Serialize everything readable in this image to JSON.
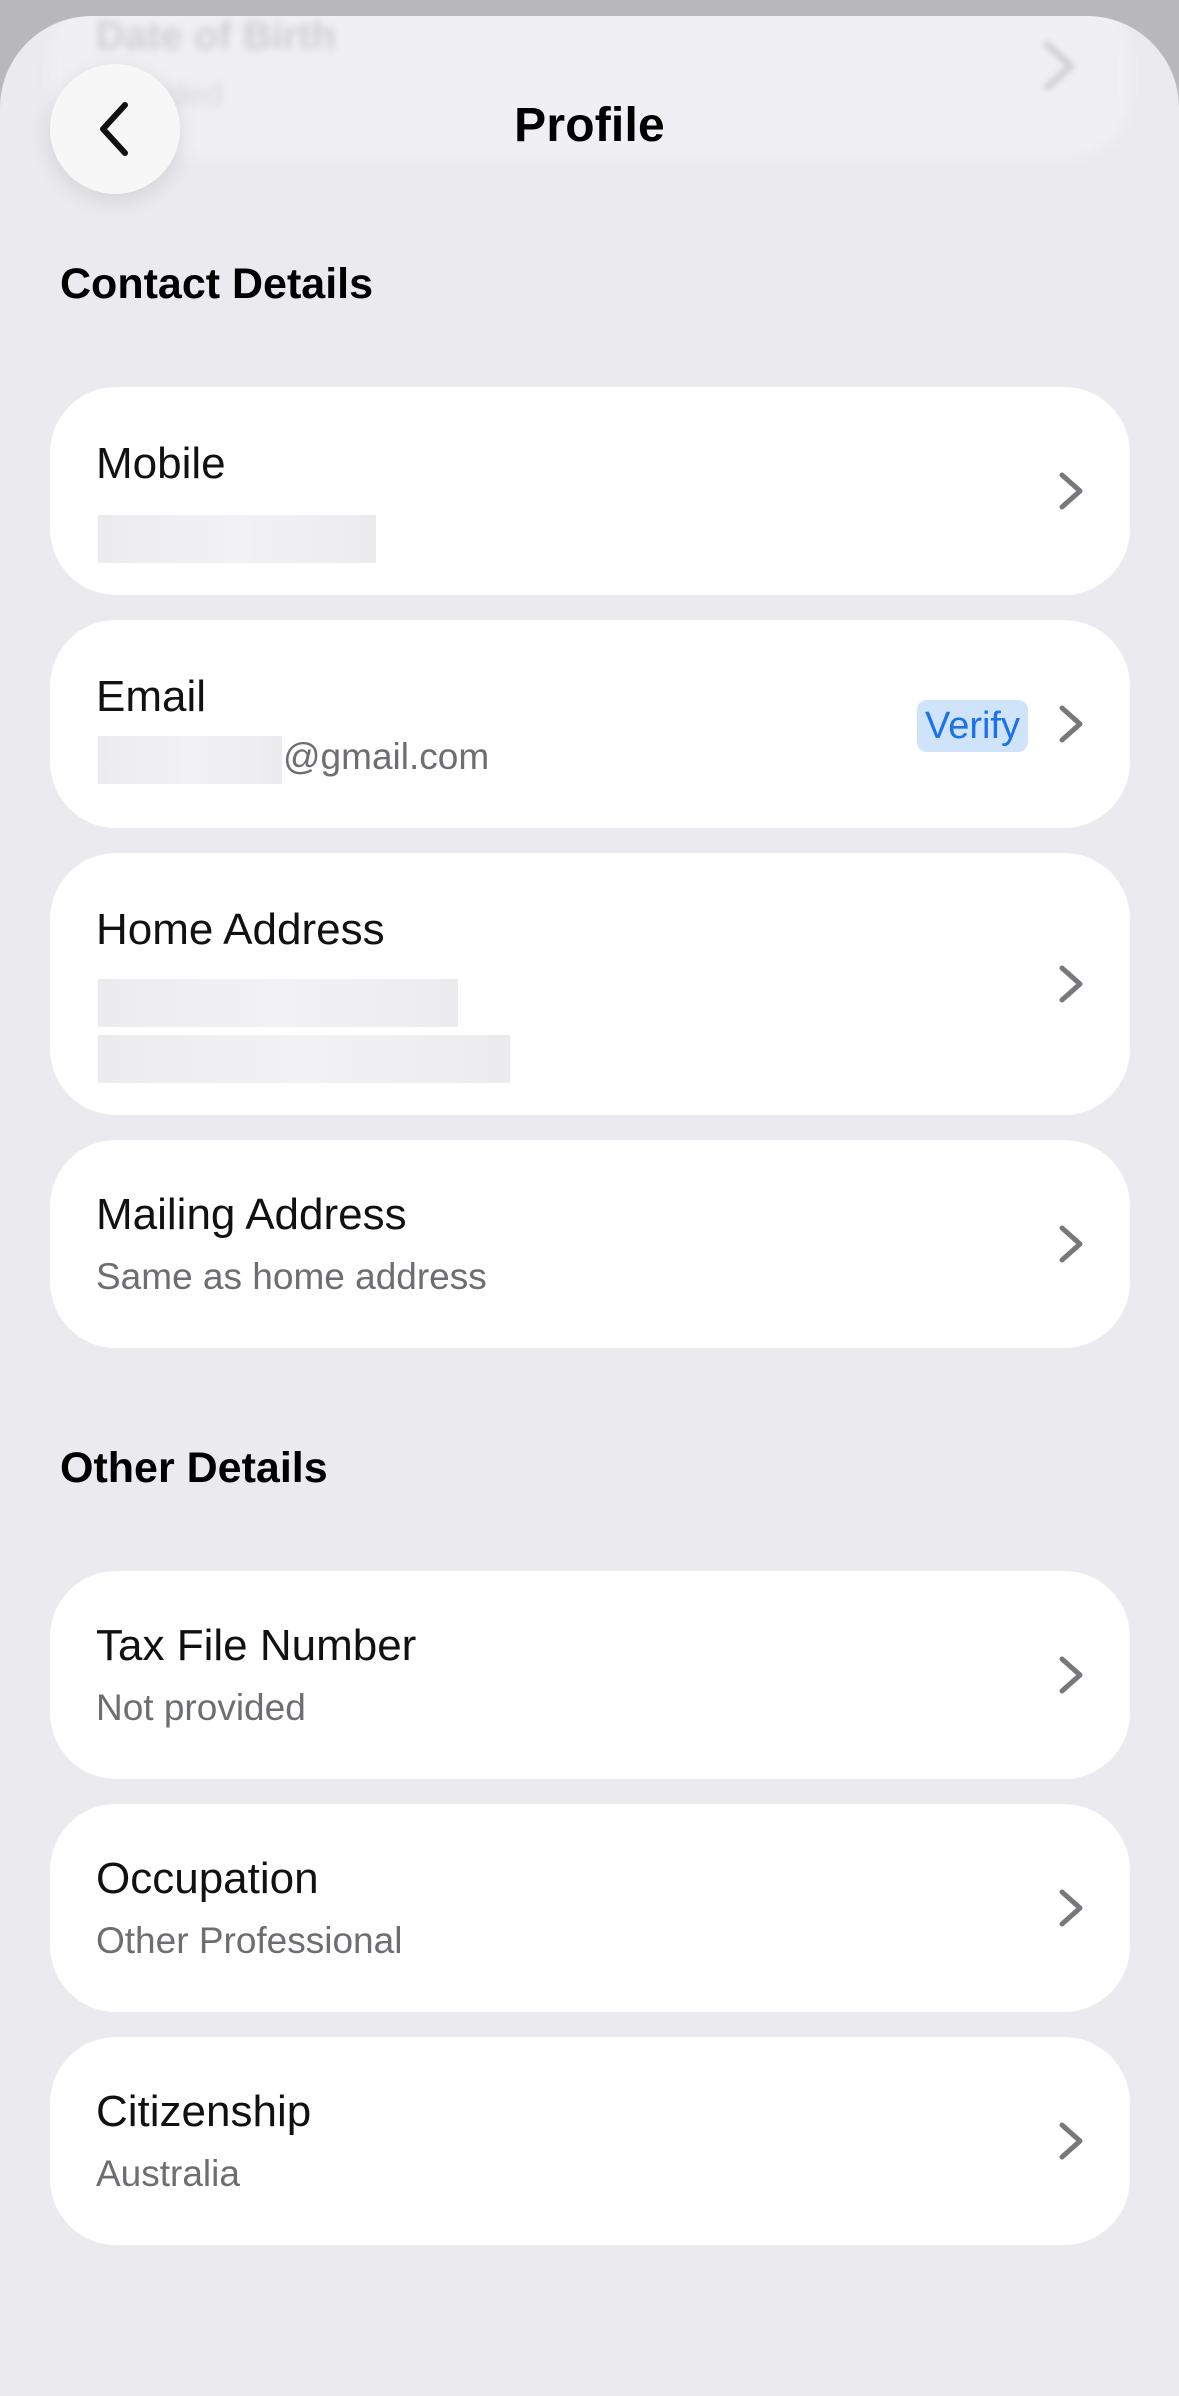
{
  "header": {
    "title": "Profile",
    "back_icon": "chevron-left-icon"
  },
  "background_row": {
    "label": "Date of Birth",
    "value": "Provided"
  },
  "contact": {
    "section_title": "Contact Details",
    "mobile": {
      "label": "Mobile"
    },
    "email": {
      "label": "Email",
      "domain": "@gmail.com",
      "verify_label": "Verify"
    },
    "home_address": {
      "label": "Home Address"
    },
    "mailing_address": {
      "label": "Mailing Address",
      "value": "Same as home address"
    }
  },
  "other": {
    "section_title": "Other Details",
    "tax_file_number": {
      "label": "Tax File Number",
      "value": "Not provided"
    },
    "occupation": {
      "label": "Occupation",
      "value": "Other Professional"
    },
    "citizenship": {
      "label": "Citizenship",
      "value": "Australia"
    }
  },
  "colors": {
    "accent": "#1a73e8",
    "badge_bg": "#cfe3fb",
    "page_bg": "#ebebef",
    "card_bg": "#ffffff",
    "secondary_text": "#6d6d72"
  }
}
